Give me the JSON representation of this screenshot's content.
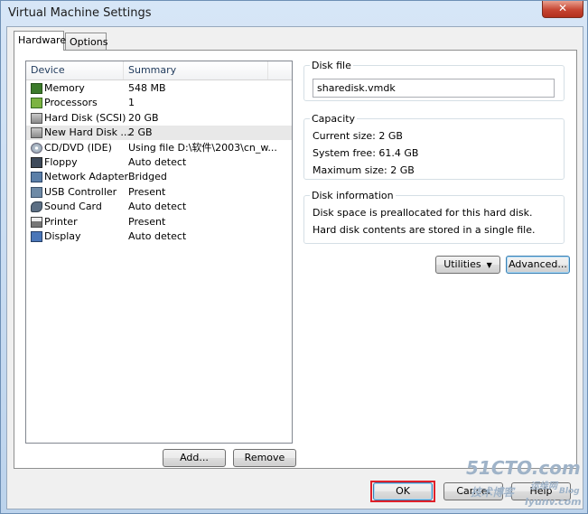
{
  "window": {
    "title": "Virtual Machine Settings",
    "close_label": "✕"
  },
  "tabs": [
    {
      "label": "Hardware",
      "active": true
    },
    {
      "label": "Options",
      "active": false
    }
  ],
  "device_list": {
    "headers": [
      "Device",
      "Summary"
    ],
    "rows": [
      {
        "name": "Memory",
        "summary": "548 MB",
        "icon": "memory-icon",
        "selected": false
      },
      {
        "name": "Processors",
        "summary": "1",
        "icon": "processor-icon",
        "selected": false
      },
      {
        "name": "Hard Disk (SCSI)",
        "summary": "20 GB",
        "icon": "hard-disk-icon",
        "selected": false
      },
      {
        "name": "New Hard Disk ...",
        "summary": "2 GB",
        "icon": "hard-disk-icon",
        "selected": true
      },
      {
        "name": "CD/DVD (IDE)",
        "summary": "Using file D:\\软件\\2003\\cn_w...",
        "icon": "cd-dvd-icon",
        "selected": false
      },
      {
        "name": "Floppy",
        "summary": "Auto detect",
        "icon": "floppy-icon",
        "selected": false
      },
      {
        "name": "Network Adapter",
        "summary": "Bridged",
        "icon": "network-adapter-icon",
        "selected": false
      },
      {
        "name": "USB Controller",
        "summary": "Present",
        "icon": "usb-icon",
        "selected": false
      },
      {
        "name": "Sound Card",
        "summary": "Auto detect",
        "icon": "sound-card-icon",
        "selected": false
      },
      {
        "name": "Printer",
        "summary": "Present",
        "icon": "printer-icon",
        "selected": false
      },
      {
        "name": "Display",
        "summary": "Auto detect",
        "icon": "display-icon",
        "selected": false
      }
    ]
  },
  "buttons": {
    "add": "Add...",
    "remove": "Remove",
    "utilities": "Utilities",
    "advanced": "Advanced...",
    "ok": "OK",
    "cancel": "Cancel",
    "help": "Help"
  },
  "disk_file": {
    "label": "Disk file",
    "value": "sharedisk.vmdk"
  },
  "capacity": {
    "label": "Capacity",
    "current_size": "Current size: 2 GB",
    "system_free": "System free: 61.4 GB",
    "maximum_size": "Maximum size: 2 GB"
  },
  "disk_information": {
    "label": "Disk information",
    "line1": "Disk space is preallocated for this hard disk.",
    "line2": "Hard disk contents are stored in a single file."
  },
  "watermark": {
    "site": "51CTO.com",
    "subtitle": "技术博客",
    "blog": "Blog",
    "url": "lyunv.com",
    "badge": "运维网"
  },
  "colors": {
    "highlight": "#e0202a",
    "selected_row": "#e8e8e8"
  }
}
